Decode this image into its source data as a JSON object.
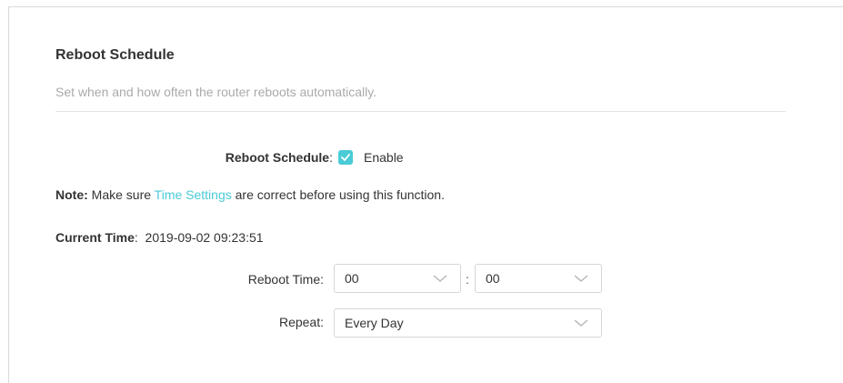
{
  "section": {
    "title": "Reboot Schedule",
    "subtitle": "Set when and how often the router reboots automatically."
  },
  "reboot_schedule": {
    "label": "Reboot Schedule",
    "colon": ":",
    "enable_label": "Enable",
    "checked": true
  },
  "note": {
    "prefix": "Note:",
    "before_link": " Make sure ",
    "link_text": "Time Settings",
    "after_link": " are correct before using this function."
  },
  "current_time": {
    "label": "Current Time",
    "colon": ":",
    "value": "2019-09-02 09:23:51"
  },
  "reboot_time": {
    "label": "Reboot Time:",
    "hour": "00",
    "separator": ":",
    "minute": "00"
  },
  "repeat": {
    "label": "Repeat:",
    "value": "Every Day"
  },
  "colors": {
    "accent": "#4acbd6",
    "text": "#333333",
    "muted": "#aaaaaa"
  }
}
